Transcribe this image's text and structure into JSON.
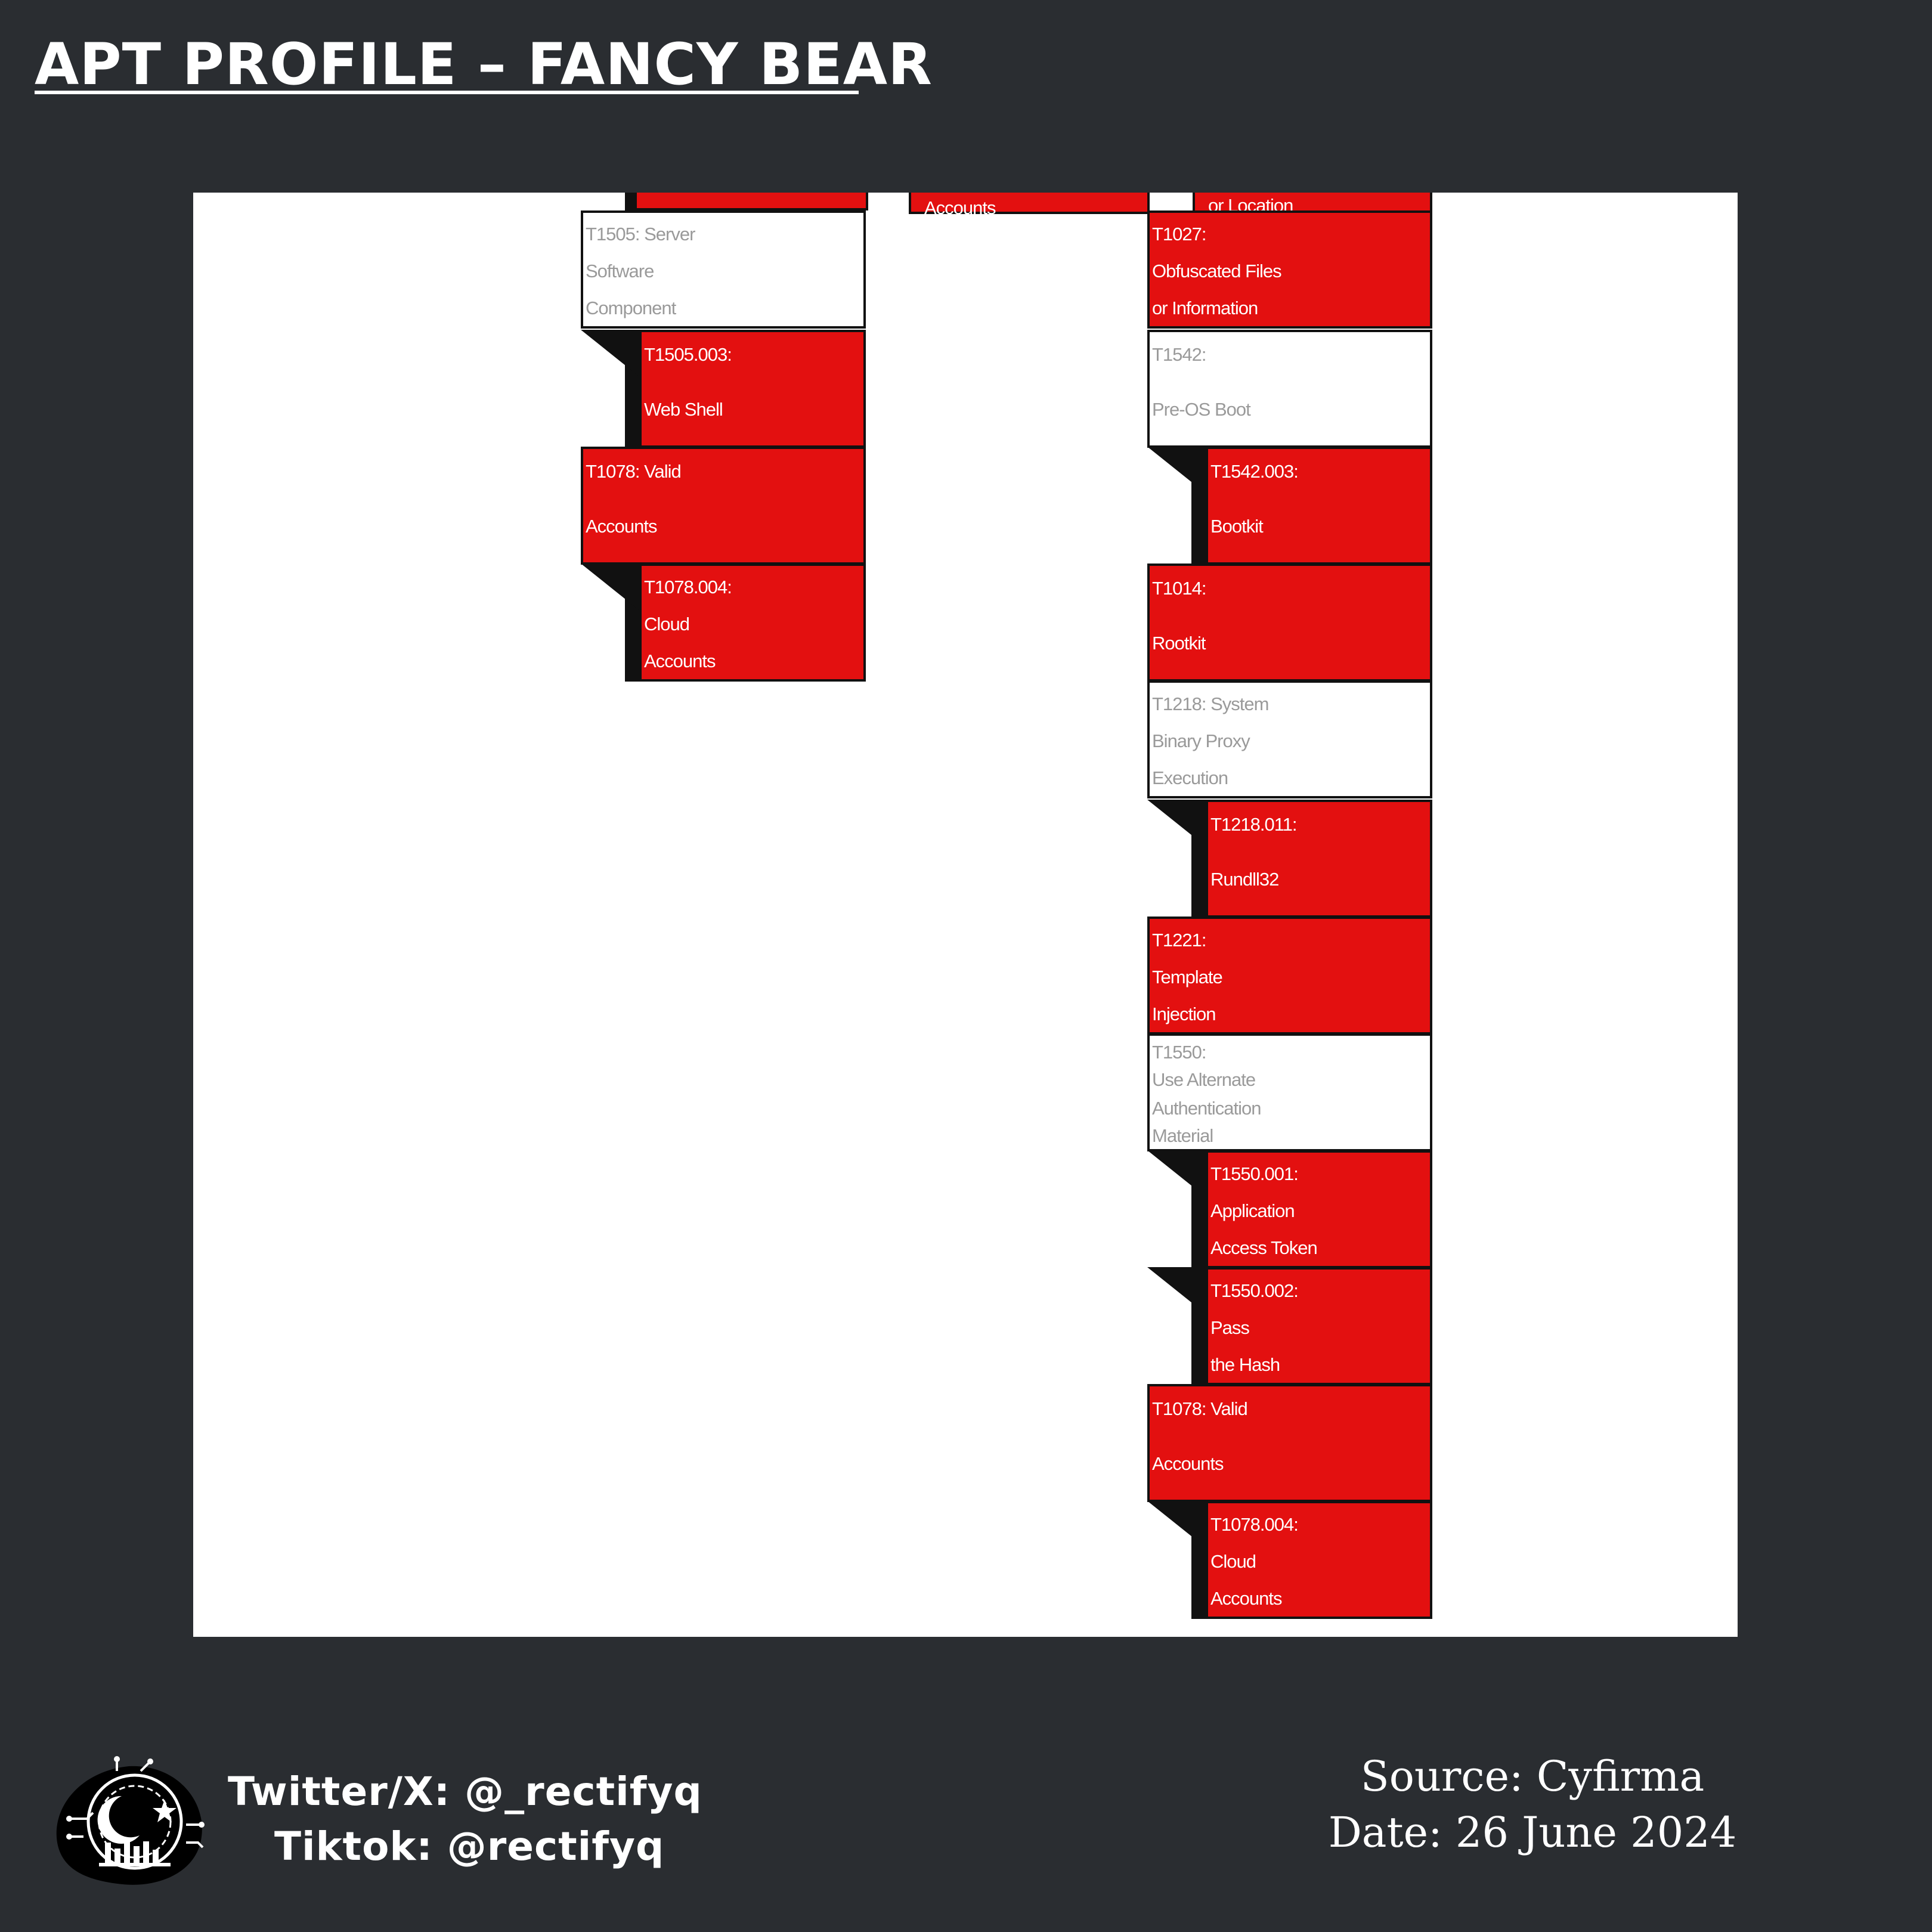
{
  "header": {
    "title": "APT PROFILE – FANCY BEAR"
  },
  "diagram": {
    "left_column": {
      "top_cut": "",
      "boxes": [
        {
          "id": "t1505",
          "lines": [
            "T1505: Server",
            "Software",
            "Component"
          ],
          "style": "technique-unused"
        },
        {
          "id": "t1505-003",
          "lines": [
            "T1505.003:",
            "Web Shell"
          ],
          "style": "subtechnique-used"
        },
        {
          "id": "t1078",
          "lines": [
            "T1078: Valid",
            "Accounts"
          ],
          "style": "technique-used"
        },
        {
          "id": "t1078-004",
          "lines": [
            "T1078.004:",
            "Cloud",
            "Accounts"
          ],
          "style": "subtechnique-used"
        }
      ]
    },
    "middle_column": {
      "top_cut": "Accounts"
    },
    "right_column": {
      "top_cut": "or Location",
      "boxes": [
        {
          "id": "t1027",
          "lines": [
            "T1027:",
            "Obfuscated Files",
            "or Information"
          ],
          "style": "technique-used"
        },
        {
          "id": "t1542",
          "lines": [
            "T1542:",
            "Pre-OS Boot"
          ],
          "style": "technique-unused"
        },
        {
          "id": "t1542-003",
          "lines": [
            "T1542.003:",
            "Bootkit"
          ],
          "style": "subtechnique-used"
        },
        {
          "id": "t1014",
          "lines": [
            "T1014:",
            "Rootkit"
          ],
          "style": "technique-used"
        },
        {
          "id": "t1218",
          "lines": [
            "T1218: System",
            "Binary Proxy",
            "Execution"
          ],
          "style": "technique-unused"
        },
        {
          "id": "t1218-011",
          "lines": [
            "T1218.011:",
            "Rundll32"
          ],
          "style": "subtechnique-used"
        },
        {
          "id": "t1221",
          "lines": [
            "T1221:",
            "Template",
            "Injection"
          ],
          "style": "technique-used"
        },
        {
          "id": "t1550",
          "lines": [
            "T1550:",
            "Use Alternate",
            "Authentication",
            "Material"
          ],
          "style": "technique-unused"
        },
        {
          "id": "t1550-001",
          "lines": [
            "T1550.001:",
            "Application",
            "Access Token"
          ],
          "style": "subtechnique-used"
        },
        {
          "id": "t1550-002",
          "lines": [
            "T1550.002:",
            "Pass",
            "the Hash"
          ],
          "style": "subtechnique-used"
        },
        {
          "id": "t1078b",
          "lines": [
            "T1078: Valid",
            "Accounts"
          ],
          "style": "technique-used"
        },
        {
          "id": "t1078-004b",
          "lines": [
            "T1078.004:",
            "Cloud",
            "Accounts"
          ],
          "style": "subtechnique-used"
        }
      ]
    },
    "colors": {
      "used": "#e31010",
      "unused": "#ffffff",
      "border": "#111111",
      "unused_text": "#9a9a9a"
    }
  },
  "footer": {
    "twitter": "Twitter/X: @_rectifyq",
    "tiktok": "Tiktok: @rectifyq",
    "source": "Source: Cyfirma",
    "date": "Date: 26 June 2024",
    "logo_icon": "crescent-moon-city-logo-icon"
  }
}
